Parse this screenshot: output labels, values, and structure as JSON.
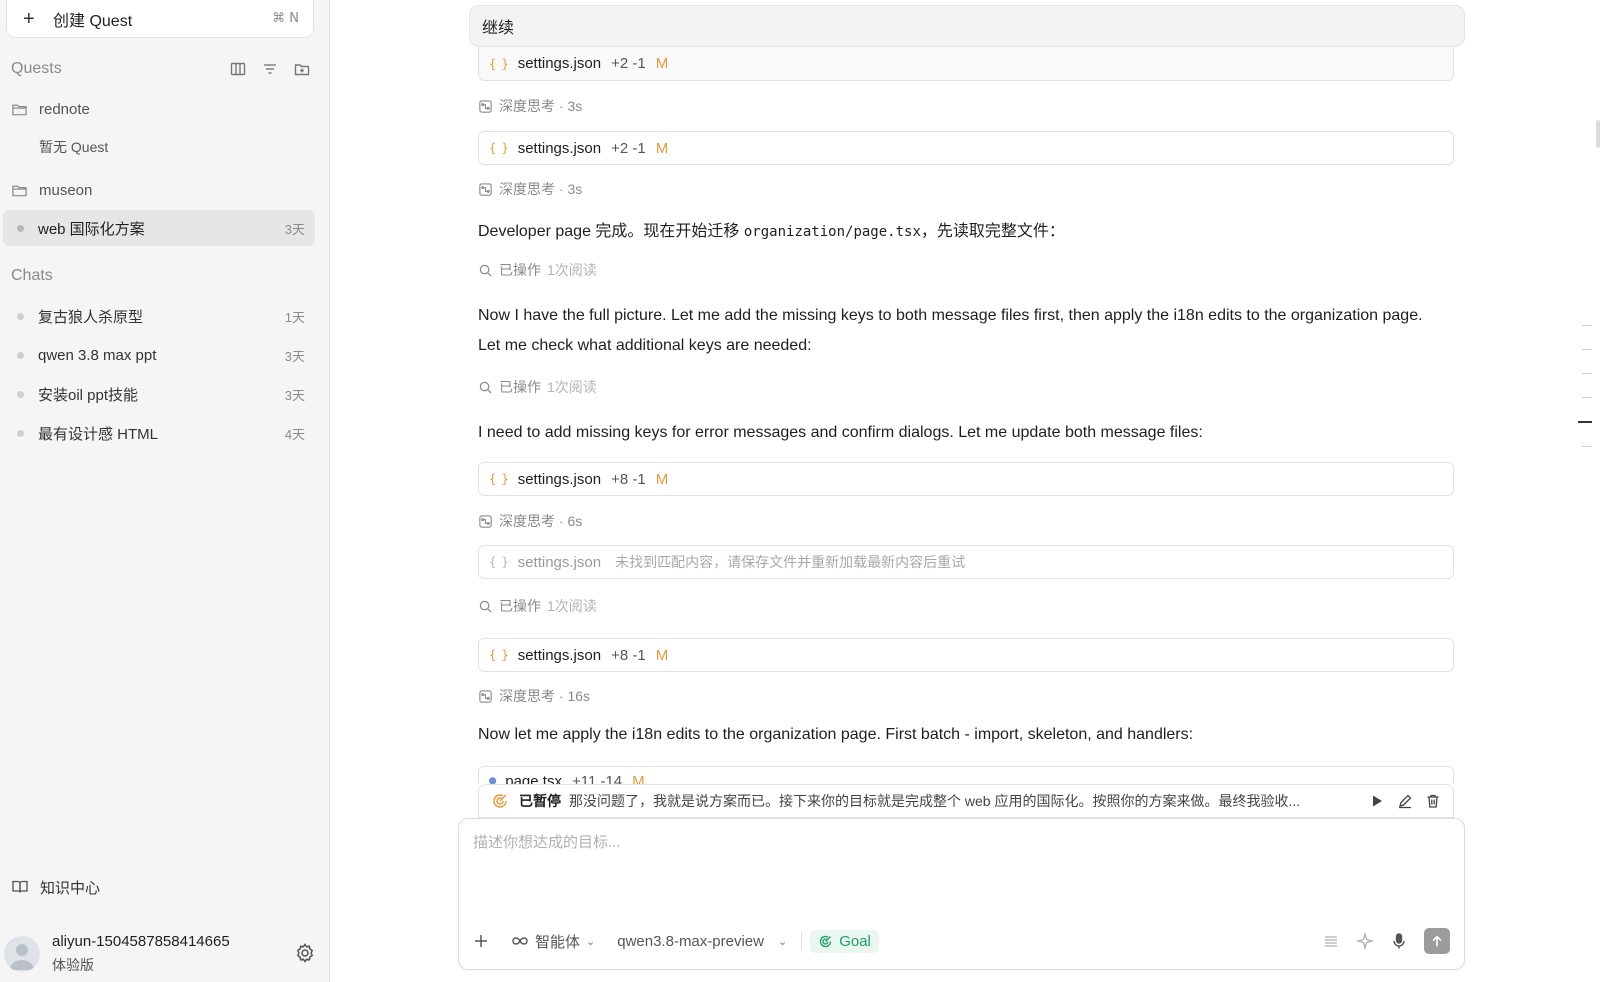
{
  "sidebar": {
    "new_quest": {
      "label": "创建 Quest",
      "shortcut": "⌘ N"
    },
    "quests_heading": "Quests",
    "folders": [
      {
        "name": "rednote",
        "empty_text": "暂无 Quest"
      },
      {
        "name": "museon"
      }
    ],
    "active_quest": {
      "name": "web 国际化方案",
      "when": "3天"
    },
    "chats_heading": "Chats",
    "chats": [
      {
        "name": "复古狼人杀原型",
        "when": "1天"
      },
      {
        "name": "qwen 3.8 max ppt",
        "when": "3天"
      },
      {
        "name": "安装oil ppt技能",
        "when": "3天"
      },
      {
        "name": "最有设计感 HTML",
        "when": "4天"
      }
    ],
    "knowledge": "知识中心",
    "user": {
      "name": "aliyun-1504587858414665",
      "plan": "体验版"
    }
  },
  "conversation": {
    "user_message": "继续",
    "cards": [
      {
        "file": "settings.json",
        "diff": "+2 -1",
        "mark": "M"
      },
      {
        "file": "settings.json",
        "diff": "+2 -1",
        "mark": "M"
      },
      {
        "file": "settings.json",
        "diff": "+8 -1",
        "mark": "M"
      },
      {
        "file": "settings.json",
        "fail": "未找到匹配内容，请保存文件并重新加载最新内容后重试"
      },
      {
        "file": "settings.json",
        "diff": "+8 -1",
        "mark": "M"
      },
      {
        "file": "page.tsx",
        "diff": "+11 -14",
        "mark": "M"
      }
    ],
    "thinking": [
      "深度思考 · 3s",
      "深度思考 · 6s",
      "深度思考 · 16s"
    ],
    "ops": {
      "label": "已操作",
      "detail": "1次阅读"
    },
    "para1_prefix": "Developer page 完成。现在开始迁移 ",
    "para1_code": "organization/page.tsx",
    "para1_suffix": "，先读取完整文件：",
    "para2": "Now I have the full picture. Let me add the missing keys to both message files first, then apply the i18n edits to the organization page. Let me check what additional keys are needed:",
    "para3": "I need to add missing keys for error messages and confirm dialogs. Let me update both message files:",
    "para4": "Now let me apply the i18n edits to the organization page. First batch - import, skeleton, and handlers:"
  },
  "paused": {
    "status": "已暂停",
    "text": "那没问题了，我就是说方案而已。接下来你的目标就是完成整个 web 应用的国际化。按照你的方案来做。最终我验收..."
  },
  "composer": {
    "placeholder": "描述你想达成的目标...",
    "agent_label": "智能体",
    "model": "qwen3.8-max-preview",
    "goal_label": "Goal"
  },
  "colors": {
    "accent_orange": "#e59a3c",
    "goal_green": "#1e9b6a"
  }
}
